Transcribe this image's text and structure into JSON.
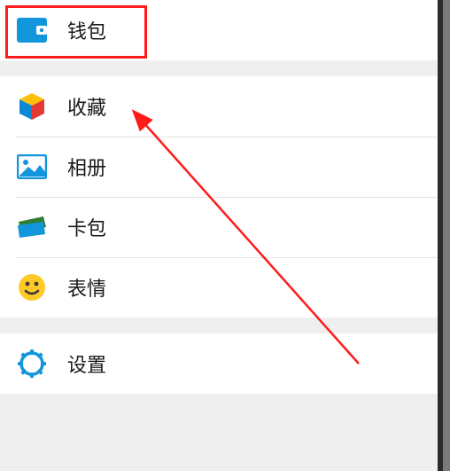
{
  "menu": {
    "wallet": "钱包",
    "favorites": "收藏",
    "album": "相册",
    "cards": "卡包",
    "stickers": "表情",
    "settings": "设置"
  }
}
